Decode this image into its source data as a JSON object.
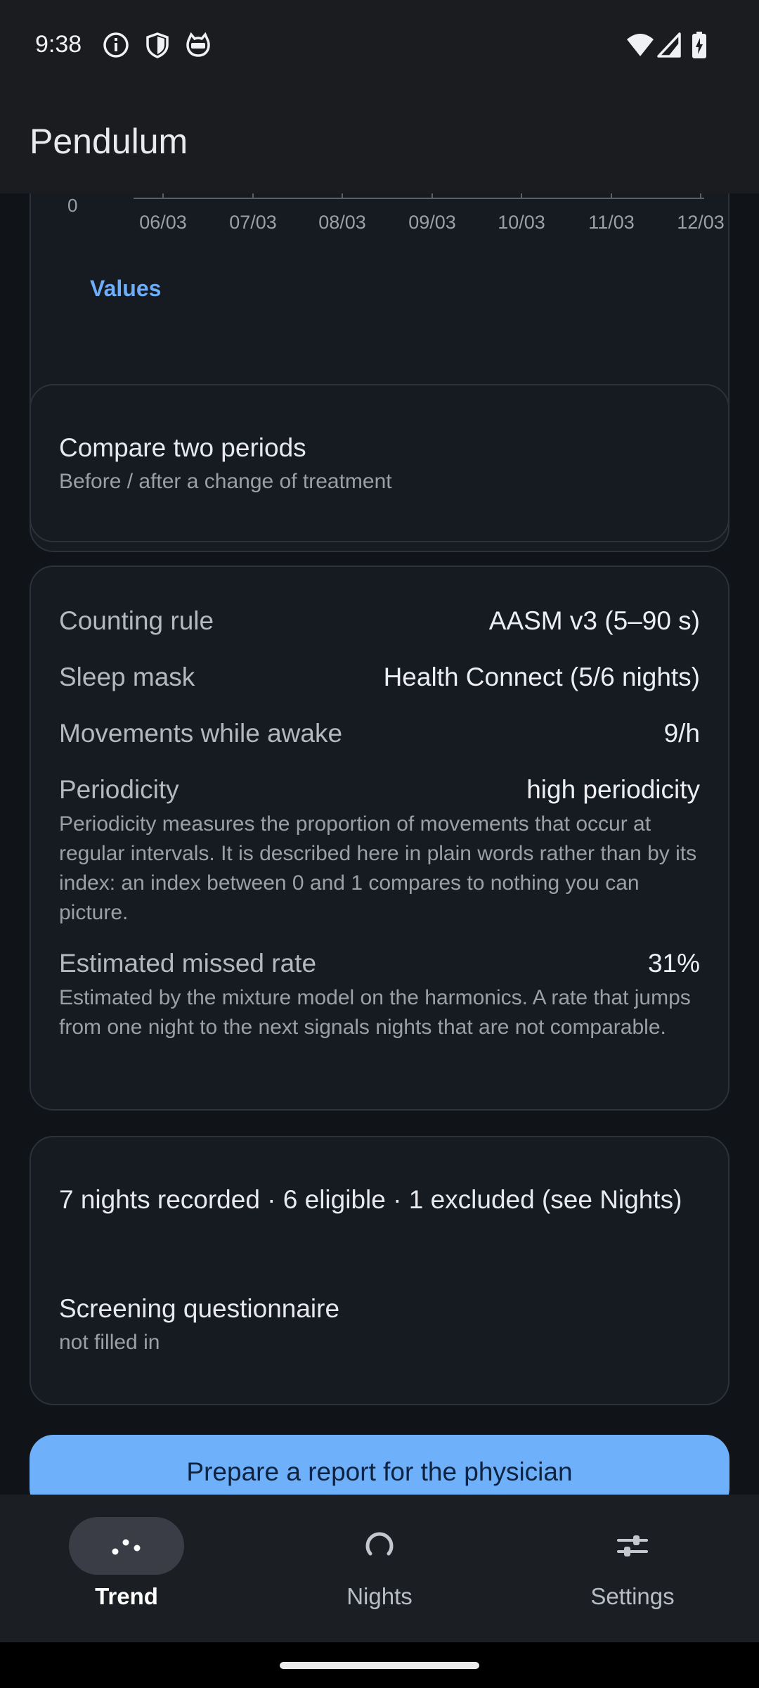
{
  "status_bar": {
    "time": "9:38",
    "left_icons": [
      "info-icon",
      "shield-icon",
      "cat-face-icon"
    ],
    "right_icons": [
      "wifi-icon",
      "cellular-signal-icon",
      "battery-charging-icon"
    ]
  },
  "app_bar": {
    "title": "Pendulum"
  },
  "chart": {
    "y_zero_label": "0",
    "x_tick_labels": [
      "06/03",
      "07/03",
      "08/03",
      "09/03",
      "10/03",
      "11/03",
      "12/03"
    ],
    "values_link": "Values"
  },
  "compare": {
    "title": "Compare two periods",
    "subtitle": "Before / after a change of treatment"
  },
  "stats": {
    "counting_rule": {
      "label": "Counting rule",
      "value": "AASM v3 (5–90 s)"
    },
    "sleep_mask": {
      "label": "Sleep mask",
      "value": "Health Connect (5/6 nights)"
    },
    "movements_awake": {
      "label": "Movements while awake",
      "value": "9/h"
    },
    "periodicity": {
      "label": "Periodicity",
      "value": "high periodicity",
      "description": "Periodicity measures the proportion of movements that occur at regular intervals. It is described here in plain words rather than by its index: an index between 0 and 1 compares to nothing you can picture."
    },
    "missed_rate": {
      "label": "Estimated missed rate",
      "value": "31%",
      "description": "Estimated by the mixture model on the harmonics. A rate that jumps from one night to the next signals nights that are not comparable."
    }
  },
  "nights": {
    "summary": "7 nights recorded · 6 eligible · 1 excluded (see Nights)",
    "questionnaire_title": "Screening questionnaire",
    "questionnaire_status": "not filled in"
  },
  "report_button": {
    "label": "Prepare a report for the physician"
  },
  "colors": {
    "accent": "#6eb0fa",
    "link": "#6eaef8",
    "background": "#101318",
    "card": "#161a21",
    "bar": "#1a1c20"
  },
  "bottom_nav": {
    "active": "Trend",
    "items": [
      {
        "label": "Trend",
        "icon": "trend-dots-icon"
      },
      {
        "label": "Nights",
        "icon": "nights-circle-icon"
      },
      {
        "label": "Settings",
        "icon": "settings-sliders-icon"
      }
    ]
  }
}
